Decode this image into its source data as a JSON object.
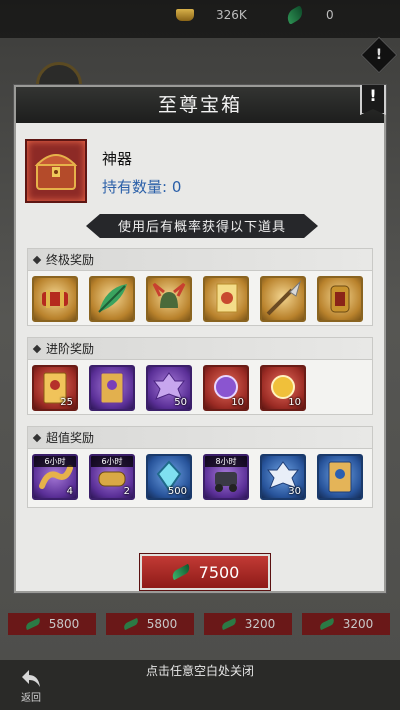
{
  "topbar": {
    "gold_value": "326K",
    "jade_value": "0"
  },
  "dialog": {
    "title": "至尊宝箱",
    "info_symbol": "!",
    "chest_name": "神器",
    "chest_count": "持有数量: 0",
    "banner_text": "使用后有概率获得以下道具",
    "sections": [
      {
        "title": "终极奖励",
        "items": [
          {
            "icon": "red-scroll-bundle-icon",
            "quality": "gold",
            "qty": ""
          },
          {
            "icon": "jade-feather-icon",
            "quality": "gold",
            "qty": ""
          },
          {
            "icon": "horned-helmet-icon",
            "quality": "gold",
            "qty": ""
          },
          {
            "icon": "banner-flag-icon",
            "quality": "gold",
            "qty": ""
          },
          {
            "icon": "spear-blade-icon",
            "quality": "gold",
            "qty": ""
          },
          {
            "icon": "lantern-relic-icon",
            "quality": "gold",
            "qty": ""
          }
        ]
      },
      {
        "title": "进阶奖励",
        "items": [
          {
            "icon": "gold-card-icon",
            "quality": "red",
            "qty": "25"
          },
          {
            "icon": "purple-card-icon",
            "quality": "purple",
            "qty": ""
          },
          {
            "icon": "purple-token-icon",
            "quality": "purple",
            "qty": "50"
          },
          {
            "icon": "purple-gem-scroll-icon",
            "quality": "red",
            "qty": "10"
          },
          {
            "icon": "gold-coin-scroll-icon",
            "quality": "red",
            "qty": "10"
          }
        ]
      },
      {
        "title": "超值奖励",
        "items": [
          {
            "icon": "golden-worm-icon",
            "quality": "purple",
            "qty": "4",
            "time": "6小时"
          },
          {
            "icon": "scroll-roll-icon",
            "quality": "purple",
            "qty": "2",
            "time": "6小时"
          },
          {
            "icon": "blue-crystal-icon",
            "quality": "blue",
            "qty": "500",
            "time": ""
          },
          {
            "icon": "mecha-figure-icon",
            "quality": "purple",
            "qty": "",
            "time": "8小时"
          },
          {
            "icon": "blue-token-icon",
            "quality": "blue",
            "qty": "30",
            "time": ""
          },
          {
            "icon": "blue-card-icon",
            "quality": "blue",
            "qty": "",
            "time": ""
          }
        ]
      }
    ],
    "price": "7500"
  },
  "shop_prices": [
    "5800",
    "5800",
    "3200",
    "3200"
  ],
  "bottombar": {
    "back_label": "返回",
    "close_hint": "点击任意空白处关闭"
  },
  "colors": {
    "dialog_bg": "#e9e9e7",
    "header_bg": "#1d1e1d",
    "price_button": "#b0302b",
    "count_text": "#2a5fa8"
  }
}
